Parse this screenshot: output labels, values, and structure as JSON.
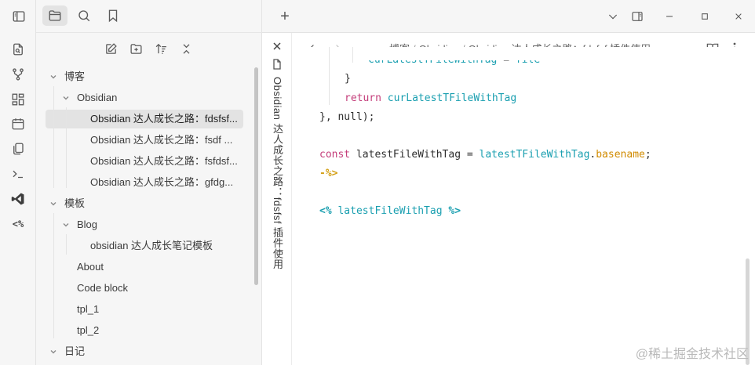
{
  "ribbon": {
    "icons": [
      "quick-switcher-icon",
      "graph-view-icon",
      "canvas-icon",
      "daily-notes-icon",
      "templates-icon",
      "terminal-icon",
      "vscode-icon",
      "code-icon"
    ],
    "code_label": "<%"
  },
  "sidebar": {
    "tabs": [
      "files-icon",
      "search-icon",
      "bookmark-icon"
    ],
    "actions": [
      "new-note-icon",
      "new-folder-icon",
      "sort-icon",
      "collapse-all-icon"
    ],
    "tree": [
      {
        "label": "博客",
        "level": 0,
        "type": "folder",
        "expanded": true
      },
      {
        "label": "Obsidian",
        "level": 1,
        "type": "folder",
        "expanded": true
      },
      {
        "label": "Obsidian 达人成长之路：fdsfsf...",
        "level": 2,
        "type": "file",
        "selected": true
      },
      {
        "label": "Obsidian 达人成长之路：fsdf ...",
        "level": 2,
        "type": "file"
      },
      {
        "label": "Obsidian 达人成长之路：fsfdsf...",
        "level": 2,
        "type": "file"
      },
      {
        "label": "Obsidian 达人成长之路：gfdg...",
        "level": 2,
        "type": "file"
      },
      {
        "label": "模板",
        "level": 0,
        "type": "folder",
        "expanded": true
      },
      {
        "label": "Blog",
        "level": 1,
        "type": "folder",
        "expanded": true
      },
      {
        "label": "obsidian 达人成长笔记模板",
        "level": 2,
        "type": "file"
      },
      {
        "label": "About",
        "level": 1,
        "type": "file"
      },
      {
        "label": "Code block",
        "level": 1,
        "type": "file"
      },
      {
        "label": "tpl_1",
        "level": 1,
        "type": "file"
      },
      {
        "label": "tpl_2",
        "level": 1,
        "type": "file"
      },
      {
        "label": "日记",
        "level": 0,
        "type": "folder",
        "expanded": true
      }
    ]
  },
  "titlebar": {
    "new_tab": "+",
    "buttons": [
      "chevron-down-icon",
      "sidebar-toggle-icon",
      "minimize-icon",
      "maximize-icon",
      "close-icon"
    ]
  },
  "stacked_tab": {
    "title": "Obsidian 达人成长之路：fdsfsf 插件使用"
  },
  "editor": {
    "breadcrumb": [
      "博客",
      "Obsidian",
      "Obsidian 达人成长之路：fdsfsf 插件使用"
    ],
    "code": {
      "line0_var": "curLatestTFileWithTag",
      "line0_eq": " = ",
      "line0_val": "file",
      "line1": "}",
      "line2_kw": "return",
      "line2_val": "curLatestTFileWithTag",
      "line3": "}, null);",
      "line5_kw": "const",
      "line5_name": " latestFileWithTag = ",
      "line5_obj": "latestTFileWithTag",
      "line5_dot": ".",
      "line5_prop": "basename",
      "line5_end": ";",
      "line6": "-%>",
      "line8_open": "<%",
      "line8_name": " latestFileWithTag ",
      "line8_close": "%>"
    }
  },
  "watermark": "@稀土掘金技术社区"
}
